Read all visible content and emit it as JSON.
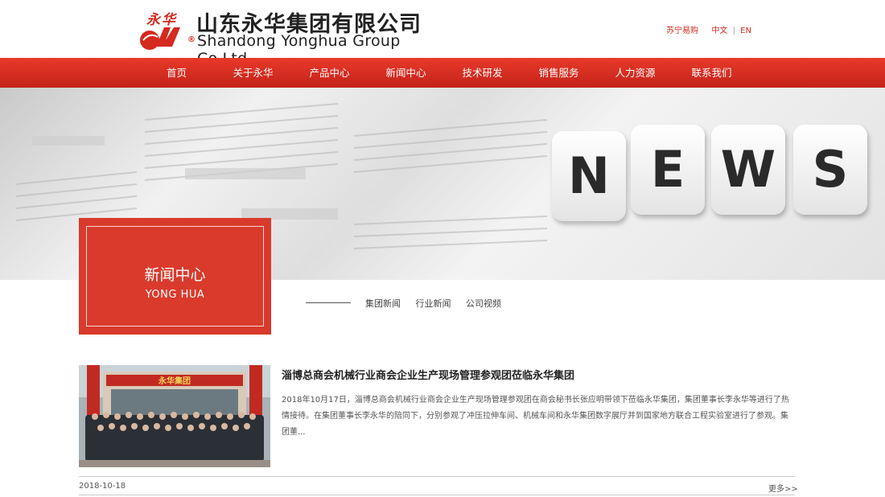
{
  "header": {
    "logo_chars": "永华",
    "logo_cn": "山东永华集团有限公司",
    "logo_reg": "®",
    "logo_en": "Shandong Yonghua Group Co.Ltd.",
    "top_links": {
      "suning": "苏宁易购",
      "zh": "中文",
      "sep": "|",
      "en": "EN"
    }
  },
  "nav": {
    "items": [
      {
        "label": "首页"
      },
      {
        "label": "关于永华"
      },
      {
        "label": "产品中心"
      },
      {
        "label": "新闻中心"
      },
      {
        "label": "技术研发"
      },
      {
        "label": "销售服务"
      },
      {
        "label": "人力资源"
      },
      {
        "label": "联系我们"
      }
    ]
  },
  "banner": {
    "dice_letters": [
      "N",
      "E",
      "W",
      "S"
    ]
  },
  "section": {
    "title": "新闻中心",
    "subtitle": "YONG HUA"
  },
  "subnav": {
    "items": [
      {
        "label": "集团新闻"
      },
      {
        "label": "行业新闻"
      },
      {
        "label": "公司视频"
      }
    ]
  },
  "news": [
    {
      "title": "淄博总商会机械行业商会企业生产现场管理参观团莅临永华集团",
      "summary": "2018年10月17日，淄博总商会机械行业商会企业生产现场管理参观团在商会秘书长张应明带领下莅临永华集团，集团董事长李永华等进行了热情接待。在集团董事长李永华的陪同下，分别参观了冲压拉伸车间、机械车间和永华集团数字展厅并到国家地方联合工程实验室进行了参观。集团董...",
      "date": "2018-10-18",
      "more": "更多>>",
      "photo_banner_text": "永华集团"
    }
  ],
  "colors": {
    "brand_red": "#d42a20",
    "nav_red": "#c4231a",
    "section_red": "#d93a2c"
  }
}
